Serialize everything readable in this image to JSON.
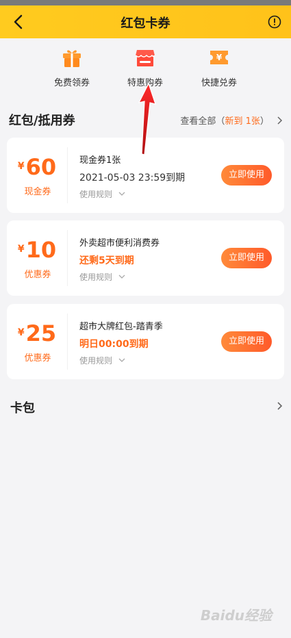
{
  "header": {
    "title": "红包卡券"
  },
  "quick_actions": [
    {
      "label": "免费领券",
      "icon": "gift-icon"
    },
    {
      "label": "特惠购券",
      "icon": "store-icon"
    },
    {
      "label": "快捷兑券",
      "icon": "voucher-exchange-icon"
    }
  ],
  "section": {
    "title": "红包/抵用券",
    "link_prefix": "查看全部（",
    "link_highlight": "新到 1张",
    "link_suffix": "）"
  },
  "coupons": [
    {
      "currency": "¥",
      "amount": "60",
      "type": "现金券",
      "title": "现金券1张",
      "subtitle": "2021-05-03 23:59到期",
      "rule": "使用规则",
      "button": "立即使用"
    },
    {
      "currency": "¥",
      "amount": "10",
      "type": "优惠券",
      "title": "外卖超市便利消费券",
      "subtitle": "还剩5天到期",
      "rule": "使用规则",
      "button": "立即使用"
    },
    {
      "currency": "¥",
      "amount": "25",
      "type": "优惠券",
      "title": "超市大牌红包-踏青季",
      "subtitle": "明日00:00到期",
      "rule": "使用规则",
      "button": "立即使用"
    }
  ],
  "card_bag": {
    "label": "卡包"
  },
  "watermark": "Baidu经验",
  "colors": {
    "header": "#ffc21a",
    "accent": "#ff6a1a",
    "arrow": "#e5161b"
  }
}
